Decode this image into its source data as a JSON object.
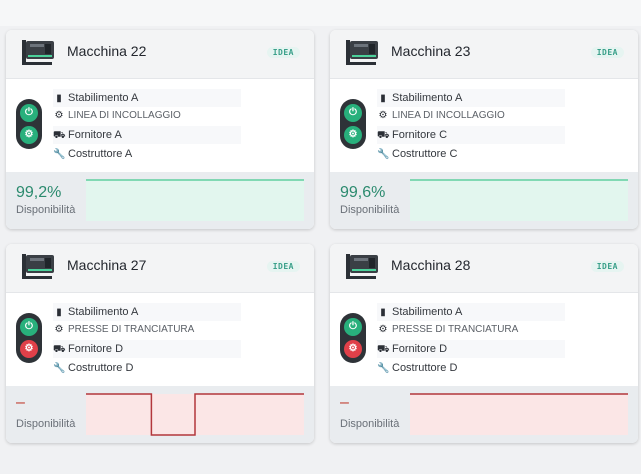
{
  "cards": [
    {
      "title": "Macchina 22",
      "badge": "IDEA",
      "plant": "Stabilimento A",
      "line": "LINEA DI INCOLLAGGIO",
      "supplier": "Fornitore A",
      "builder": "Costruttore A",
      "availability": "99,2%",
      "availability_label": "Disponibilità",
      "status": "green",
      "trend": [
        1,
        1,
        1,
        1,
        1,
        1,
        1,
        1,
        1,
        1
      ],
      "colors": {
        "line": "#5fcf9f",
        "fill": "#e2f6ee"
      }
    },
    {
      "title": "Macchina 23",
      "badge": "IDEA",
      "plant": "Stabilimento A",
      "line": "LINEA DI INCOLLAGGIO",
      "supplier": "Fornitore C",
      "builder": "Costruttore C",
      "availability": "99,6%",
      "availability_label": "Disponibilità",
      "status": "green",
      "trend": [
        1,
        1,
        1,
        1,
        1,
        1,
        1,
        1,
        1,
        1
      ],
      "colors": {
        "line": "#5fcf9f",
        "fill": "#e2f6ee"
      }
    },
    {
      "title": "Macchina 27",
      "badge": "IDEA",
      "plant": "Stabilimento A",
      "line": "PRESSE DI TRANCIATURA",
      "supplier": "Fornitore D",
      "builder": "Costruttore D",
      "availability": "–",
      "availability_label": "Disponibilità",
      "status": "red",
      "trend": [
        1,
        1,
        1,
        0,
        0,
        1,
        1,
        1,
        1,
        1
      ],
      "colors": {
        "line": "#b2373c",
        "fill": "#fbe6e6"
      }
    },
    {
      "title": "Macchina 28",
      "badge": "IDEA",
      "plant": "Stabilimento A",
      "line": "PRESSE DI TRANCIATURA",
      "supplier": "Fornitore D",
      "builder": "Costruttore D",
      "availability": "–",
      "availability_label": "Disponibilità",
      "status": "red",
      "trend": [
        1,
        1,
        1,
        1,
        1,
        1,
        1,
        1,
        1,
        1
      ],
      "colors": {
        "line": "#b2373c",
        "fill": "#fbe6e6"
      }
    }
  ]
}
